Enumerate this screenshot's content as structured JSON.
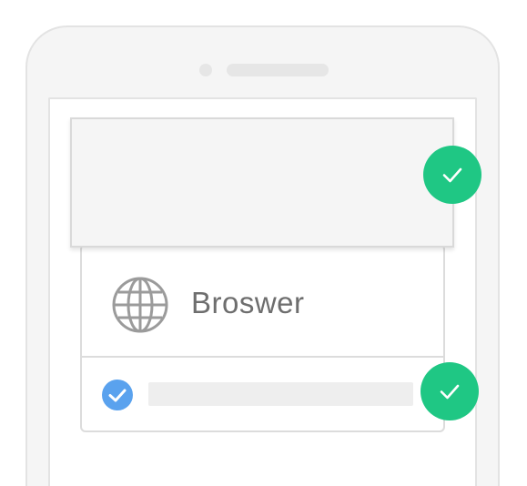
{
  "app": {
    "option_label": "Broswer",
    "icons": {
      "globe": "globe-icon",
      "checkbox": "checkbox-checked-icon",
      "badge": "checkmark-icon"
    },
    "colors": {
      "accent_green": "#1fc784",
      "checkbox_blue": "#5aa2ee",
      "label_gray": "#6e6e6e"
    }
  }
}
